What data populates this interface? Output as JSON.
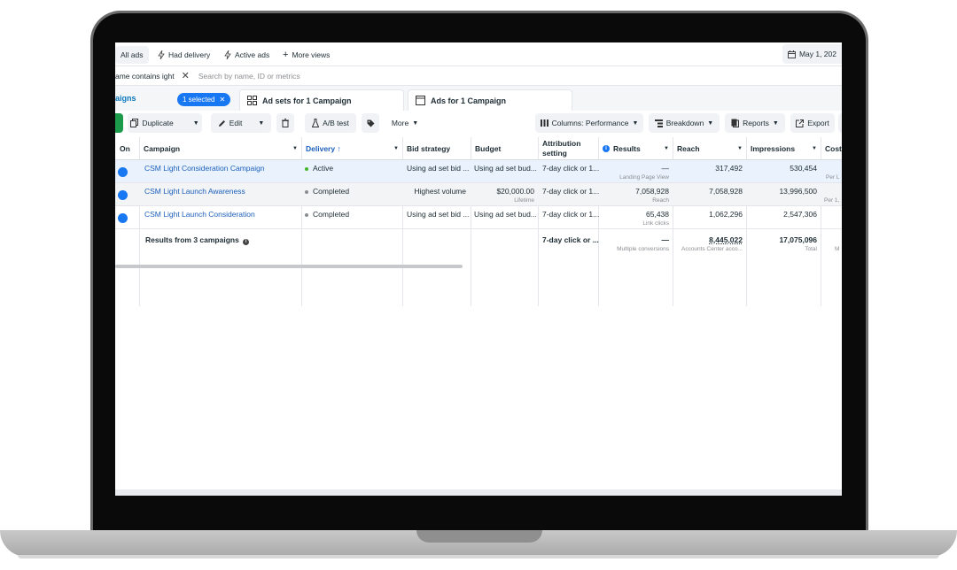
{
  "view_tabs": {
    "all_ads": "All ads",
    "had_delivery": "Had delivery",
    "active_ads": "Active ads",
    "more_views": "More views",
    "date": "May 1, 202"
  },
  "search": {
    "filter_chip": "ame contains ight",
    "placeholder": "Search by name, ID or metrics"
  },
  "levels": {
    "campaigns": "aigns",
    "selected_pill": "1 selected",
    "ad_sets": "Ad sets for 1 Campaign",
    "ads": "Ads for 1 Campaign"
  },
  "toolbar": {
    "duplicate": "Duplicate",
    "edit": "Edit",
    "ab_test": "A/B test",
    "more": "More",
    "columns": "Columns: Performance",
    "breakdown": "Breakdown",
    "reports": "Reports",
    "export": "Export"
  },
  "table": {
    "headers": {
      "on": "On",
      "campaign": "Campaign",
      "delivery": "Delivery ↑",
      "bid_strategy": "Bid strategy",
      "budget": "Budget",
      "attribution_line1": "Attribution",
      "attribution_line2": "setting",
      "results": "Results",
      "reach": "Reach",
      "impressions": "Impressions",
      "cost": "Cost"
    },
    "rows": [
      {
        "campaign": "CSM Light Consideration Campaign",
        "delivery": "Active",
        "bid_strategy": "Using ad set bid ...",
        "budget": "Using ad set bud...",
        "budget_sub": "",
        "attribution": "7-day click or 1...",
        "results": "—",
        "results_sub": "Landing Page View",
        "reach": "317,492",
        "impressions": "530,454",
        "cost_sub": "Per L"
      },
      {
        "campaign": "CSM Light Launch Awareness",
        "delivery": "Completed",
        "bid_strategy": "Highest volume",
        "budget": "$20,000.00",
        "budget_sub": "Lifetime",
        "attribution": "7-day click or 1...",
        "results": "7,058,928",
        "results_sub": "Reach",
        "reach": "7,058,928",
        "impressions": "13,996,500",
        "cost_sub": "Per 1,"
      },
      {
        "campaign": "CSM Light Launch Consideration",
        "delivery": "Completed",
        "bid_strategy": "Using ad set bid ...",
        "budget": "Using ad set bud...",
        "budget_sub": "",
        "attribution": "7-day click or 1...",
        "results": "65,438",
        "results_sub": "Link clicks",
        "reach": "1,062,296",
        "impressions": "2,547,306",
        "cost_sub": ""
      }
    ],
    "summary": {
      "label": "Results from 3 campaigns",
      "attribution": "7-day click or ...",
      "results": "—",
      "results_sub": "Multiple conversions",
      "reach": "8,445,022",
      "reach_sub": "Accounts Center acco...",
      "impressions": "17,075,096",
      "impressions_sub": "Total",
      "cost_sub": "M"
    }
  },
  "colors": {
    "accent": "#1877f2",
    "link": "#1c5fbb",
    "active_dot": "#42b72a",
    "completed_dot": "#8a8d91",
    "create_button": "#1a9a4a"
  }
}
